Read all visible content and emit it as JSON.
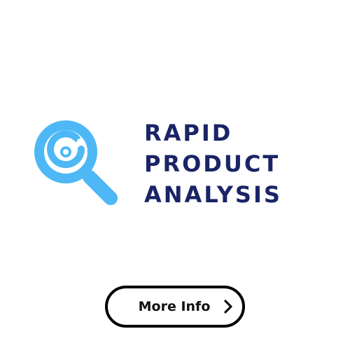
{
  "brand": {
    "title_lines": [
      "RAPID",
      "PRODUCT",
      "ANALYSIS"
    ],
    "title_color": "#1a2466",
    "icon_color": "#4db8f5",
    "icon": "magnifier-icon"
  },
  "cta": {
    "label": "More Info",
    "icon": "chevron-right-icon"
  }
}
